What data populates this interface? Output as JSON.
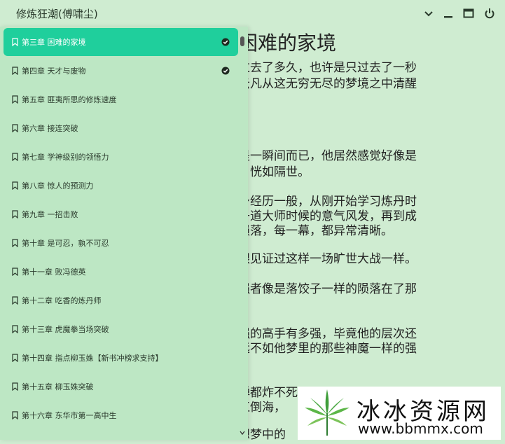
{
  "window": {
    "title": "修炼狂潮(傅啸尘)",
    "controls": [
      "chevron-down-icon",
      "minimize-icon",
      "maximize-icon",
      "power-icon"
    ]
  },
  "reader": {
    "chapter_heading": "困难的家境",
    "paragraphs": [
      "过去了多久，也许是只过去了一秒",
      "云凡从这无穷无尽的梦境之中清醒",
      "是一瞬间而已，他居然感觉好像是",
      "，恍如隔世。",
      "身经历一般，从刚开始学习炼丹时",
      "丹道大师时候的意气风发，再到成",
      "陨落，每一幕，都异常清晰。",
      "眼见证过这样一场旷世大战一样。",
      "强者像是落饺子一样的陨落在了那",
      "强的高手有多强，毕竟他的层次还",
      "远不如他梦里的那些神魔一样的强",
      "弹都炸不死",
      "江倒海，",
      "想梦中的"
    ]
  },
  "sidebar": {
    "chapters": [
      {
        "label": "第三章 困难的家境",
        "active": true,
        "read": true
      },
      {
        "label": "第四章 天才与废物",
        "active": false,
        "read": true
      },
      {
        "label": "第五章 匪夷所思的修炼速度",
        "active": false,
        "read": false
      },
      {
        "label": "第六章 接连突破",
        "active": false,
        "read": false
      },
      {
        "label": "第七章 学神级别的领悟力",
        "active": false,
        "read": false
      },
      {
        "label": "第八章 惊人的预测力",
        "active": false,
        "read": false
      },
      {
        "label": "第九章 一招击败",
        "active": false,
        "read": false
      },
      {
        "label": "第十章 是可忍，孰不可忍",
        "active": false,
        "read": false
      },
      {
        "label": "第十一章 败冯德英",
        "active": false,
        "read": false
      },
      {
        "label": "第十二章 吃香的炼丹师",
        "active": false,
        "read": false
      },
      {
        "label": "第十三章 虎魔拳当场突破",
        "active": false,
        "read": false
      },
      {
        "label": "第十四章 指点柳玉姝【新书冲榜求支持】",
        "active": false,
        "read": false
      },
      {
        "label": "第十五章 柳玉姝突破",
        "active": false,
        "read": false
      },
      {
        "label": "第十六章 东华市第一高中生",
        "active": false,
        "read": false
      }
    ]
  },
  "watermark": {
    "text": "冰冰资源网",
    "url": "www.bbmmx.com"
  },
  "colors": {
    "background": "#cfecd1",
    "sidebar": "#bde7c4",
    "accent": "#1fcf9c"
  }
}
